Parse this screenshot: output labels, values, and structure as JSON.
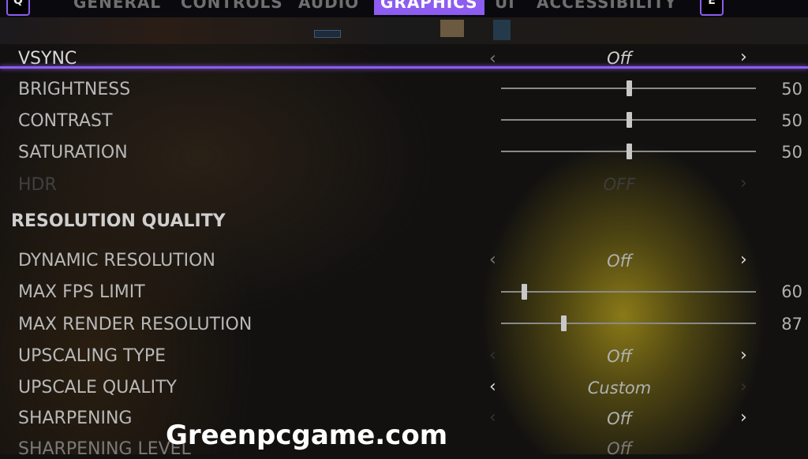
{
  "tabs": {
    "prev_key": "Q",
    "next_key": "E",
    "items": [
      "GENERAL",
      "CONTROLS",
      "AUDIO",
      "GRAPHICS",
      "UI",
      "ACCESSIBILITY"
    ],
    "active": "GRAPHICS"
  },
  "accent_color": "#8d5cf0",
  "settings": {
    "vsync": {
      "label": "VSYNC",
      "value": "Off"
    },
    "brightness": {
      "label": "BRIGHTNESS",
      "value": "50",
      "fraction": 0.5
    },
    "contrast": {
      "label": "CONTRAST",
      "value": "50",
      "fraction": 0.5
    },
    "saturation": {
      "label": "SATURATION",
      "value": "50",
      "fraction": 0.5
    },
    "hdr": {
      "label": "HDR",
      "value": "OFF"
    }
  },
  "resolution_section": {
    "title": "RESOLUTION QUALITY",
    "dynamic_resolution": {
      "label": "DYNAMIC RESOLUTION",
      "value": "Off"
    },
    "max_fps_limit": {
      "label": "MAX FPS LIMIT",
      "value": "60",
      "fraction": 0.09
    },
    "max_render_resolution": {
      "label": "MAX RENDER RESOLUTION",
      "value": "87",
      "fraction": 0.245
    },
    "upscaling_type": {
      "label": "UPSCALING TYPE",
      "value": "Off"
    },
    "upscale_quality": {
      "label": "UPSCALE QUALITY",
      "value": "Custom"
    },
    "sharpening": {
      "label": "SHARPENING",
      "value": "Off"
    },
    "sharpening_level": {
      "label": "SHARPENING LEVEL",
      "value": "Off"
    }
  },
  "arrows": {
    "left": "‹",
    "right": "›"
  },
  "watermark": "Greenpcgame.com"
}
